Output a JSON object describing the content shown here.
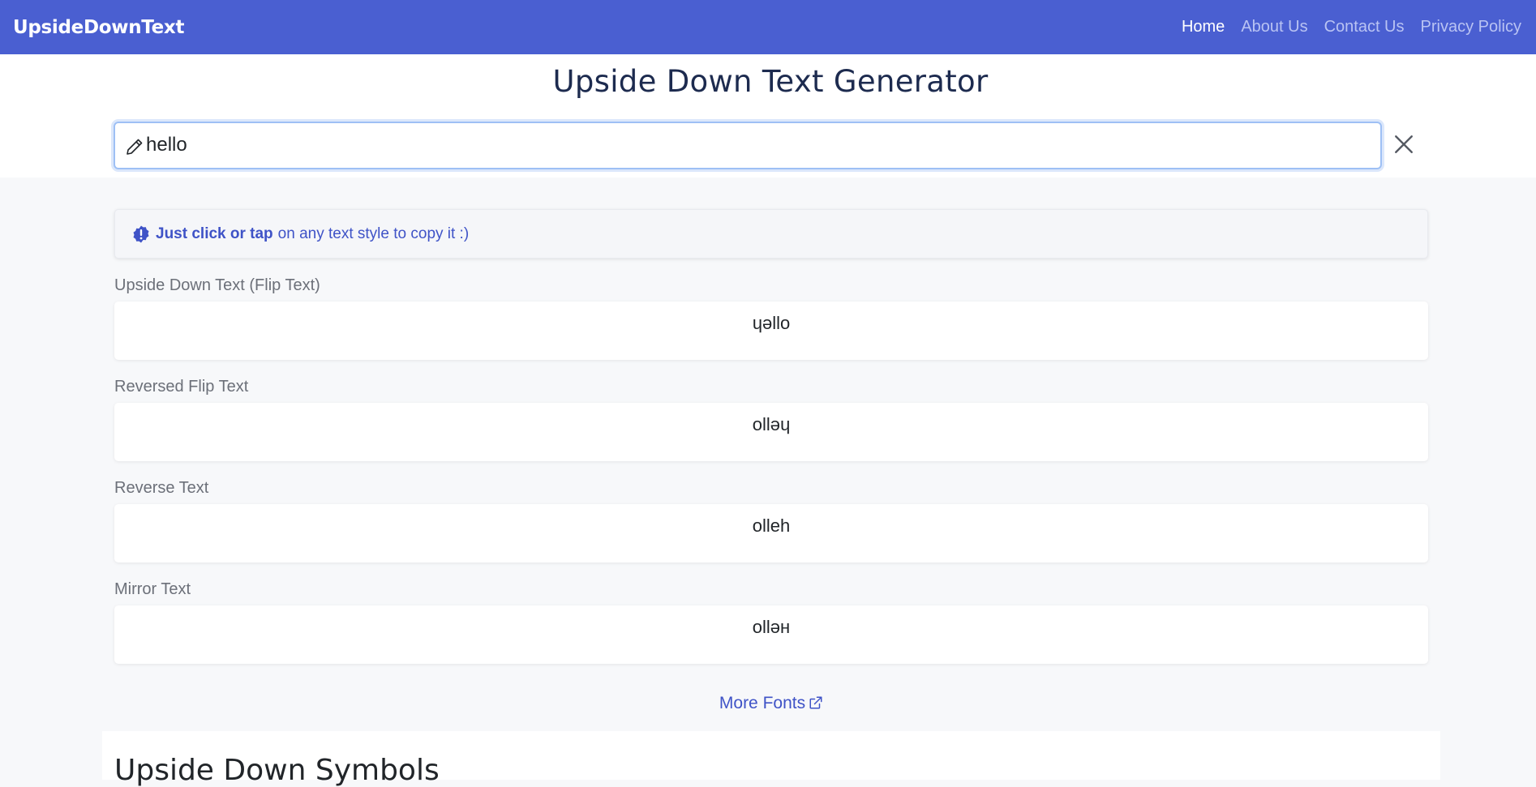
{
  "nav": {
    "brand": "UpsideDownText",
    "links": [
      "Home",
      "About Us",
      "Contact Us",
      "Privacy Policy"
    ],
    "active": "Home"
  },
  "header": {
    "title": "Upside Down Text Generator",
    "input_value": "hello"
  },
  "tip": {
    "strong": "Just click or tap",
    "rest": "on any text style to copy it :)"
  },
  "styles": [
    {
      "label": "Upside Down Text (Flip Text)",
      "value": "ɥǝllo"
    },
    {
      "label": "Reversed Flip Text",
      "value": "ollǝɥ"
    },
    {
      "label": "Reverse Text",
      "value": "olleh"
    },
    {
      "label": "Mirror Text",
      "value": "ollǝн"
    }
  ],
  "more_fonts": "More Fonts",
  "bottom": {
    "title": "Upside Down Symbols"
  },
  "colors": {
    "navbar": "#4a5fd1",
    "accent": "#3f53c7",
    "background": "#f7f8fa"
  }
}
